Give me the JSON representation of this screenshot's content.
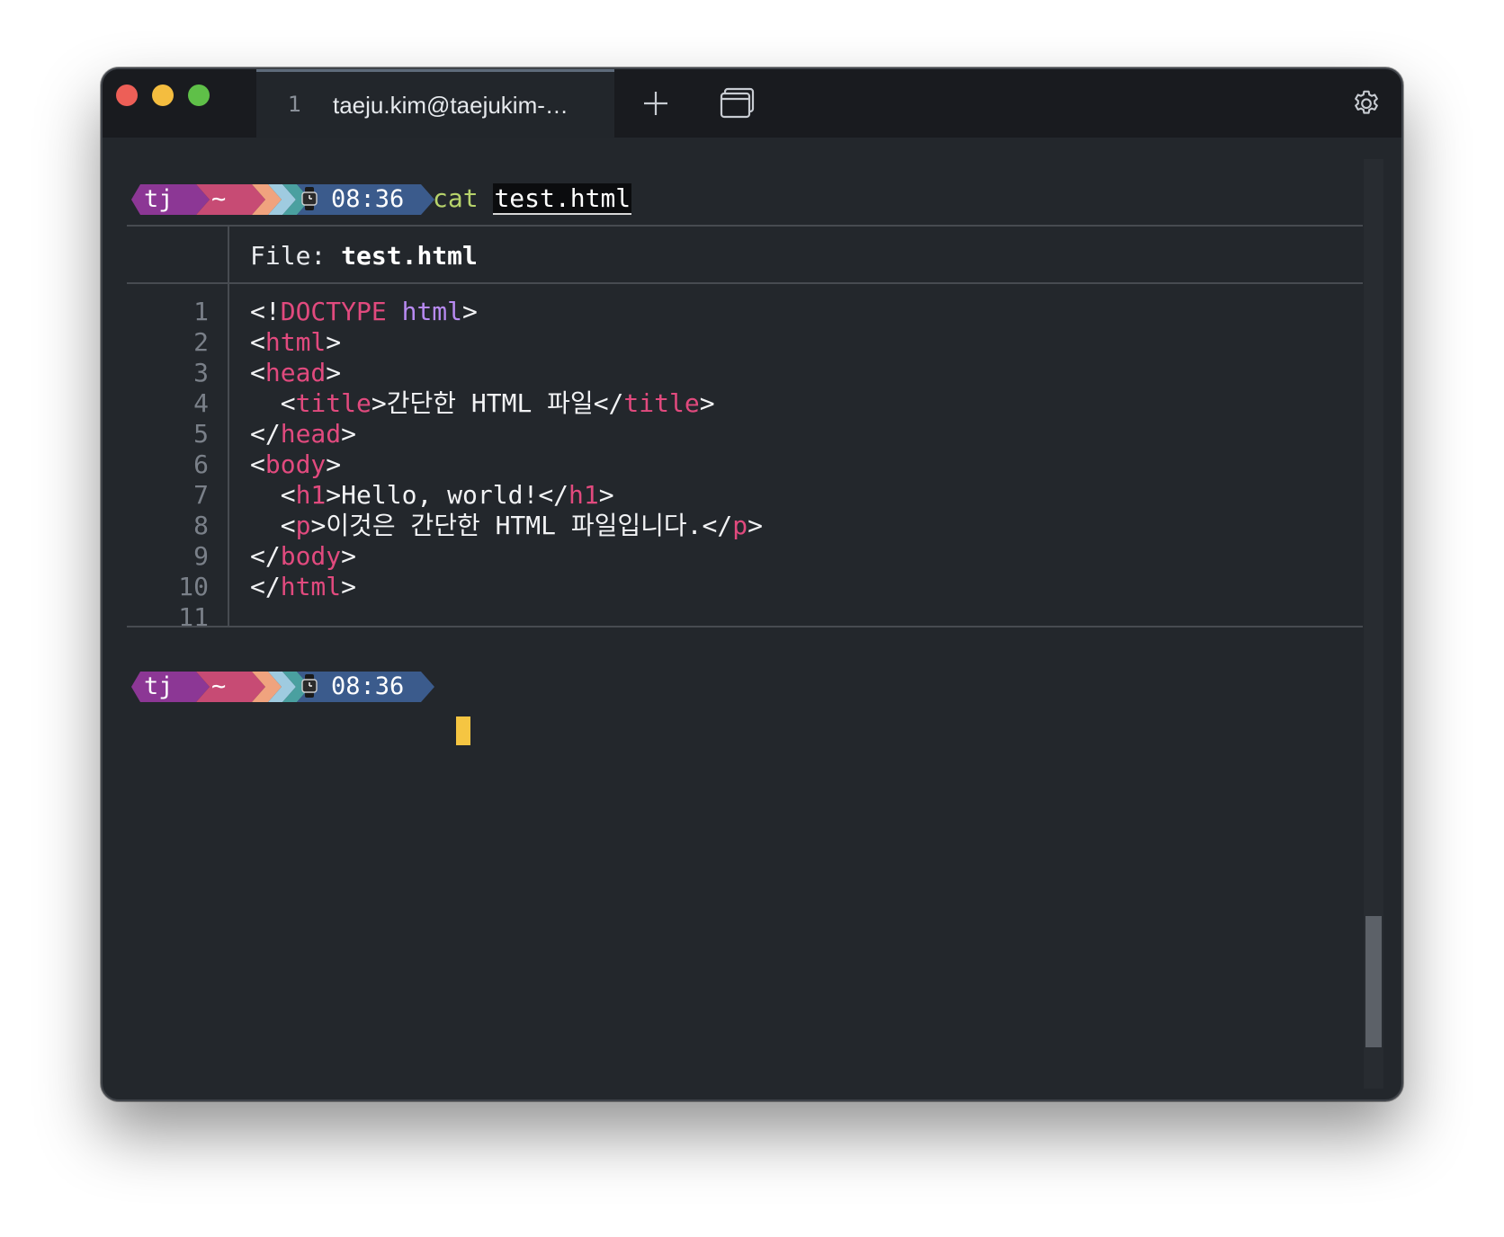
{
  "window": {
    "tab_number": "1",
    "tab_title": "taeju.kim@taejukim-…"
  },
  "prompt": {
    "user": "tj",
    "dir": "~",
    "clock_icon": "watch-icon",
    "time": "08:36",
    "colors": {
      "user": "#8c3795",
      "dir": "#c74b74",
      "chevron1": "#f0a37e",
      "chevron2": "#9fcbe0",
      "chevron3": "#4aa0a0",
      "time": "#3b5b8c"
    }
  },
  "command": {
    "name": "cat",
    "arg": "test.html"
  },
  "file_view": {
    "label": "File: ",
    "filename": "test.html",
    "line_numbers": [
      "1",
      "2",
      "3",
      "4",
      "5",
      "6",
      "7",
      "8",
      "9",
      "10",
      "11"
    ],
    "lines": [
      [
        {
          "t": "punct",
          "v": "<!"
        },
        {
          "t": "tag",
          "v": "DOCTYPE"
        },
        {
          "t": "text",
          "v": " "
        },
        {
          "t": "kw",
          "v": "html"
        },
        {
          "t": "punct",
          "v": ">"
        }
      ],
      [
        {
          "t": "punct",
          "v": "<"
        },
        {
          "t": "tag",
          "v": "html"
        },
        {
          "t": "punct",
          "v": ">"
        }
      ],
      [
        {
          "t": "punct",
          "v": "<"
        },
        {
          "t": "tag",
          "v": "head"
        },
        {
          "t": "punct",
          "v": ">"
        }
      ],
      [
        {
          "t": "text",
          "v": "  "
        },
        {
          "t": "punct",
          "v": "<"
        },
        {
          "t": "tag",
          "v": "title"
        },
        {
          "t": "punct",
          "v": ">"
        },
        {
          "t": "text",
          "v": "간단한 HTML 파일"
        },
        {
          "t": "punct",
          "v": "</"
        },
        {
          "t": "tag",
          "v": "title"
        },
        {
          "t": "punct",
          "v": ">"
        }
      ],
      [
        {
          "t": "punct",
          "v": "</"
        },
        {
          "t": "tag",
          "v": "head"
        },
        {
          "t": "punct",
          "v": ">"
        }
      ],
      [
        {
          "t": "punct",
          "v": "<"
        },
        {
          "t": "tag",
          "v": "body"
        },
        {
          "t": "punct",
          "v": ">"
        }
      ],
      [
        {
          "t": "text",
          "v": "  "
        },
        {
          "t": "punct",
          "v": "<"
        },
        {
          "t": "tag",
          "v": "h1"
        },
        {
          "t": "punct",
          "v": ">"
        },
        {
          "t": "text",
          "v": "Hello, world!"
        },
        {
          "t": "punct",
          "v": "</"
        },
        {
          "t": "tag",
          "v": "h1"
        },
        {
          "t": "punct",
          "v": ">"
        }
      ],
      [
        {
          "t": "text",
          "v": "  "
        },
        {
          "t": "punct",
          "v": "<"
        },
        {
          "t": "tag",
          "v": "p"
        },
        {
          "t": "punct",
          "v": ">"
        },
        {
          "t": "text",
          "v": "이것은 간단한 HTML 파일입니다."
        },
        {
          "t": "punct",
          "v": "</"
        },
        {
          "t": "tag",
          "v": "p"
        },
        {
          "t": "punct",
          "v": ">"
        }
      ],
      [
        {
          "t": "punct",
          "v": "</"
        },
        {
          "t": "tag",
          "v": "body"
        },
        {
          "t": "punct",
          "v": ">"
        }
      ],
      [
        {
          "t": "punct",
          "v": "</"
        },
        {
          "t": "tag",
          "v": "html"
        },
        {
          "t": "punct",
          "v": ">"
        }
      ],
      []
    ]
  },
  "icons": {
    "new_tab": "plus-icon",
    "panes": "window-panes-icon",
    "settings": "gear-icon"
  },
  "cursor_color": "#f5c542"
}
